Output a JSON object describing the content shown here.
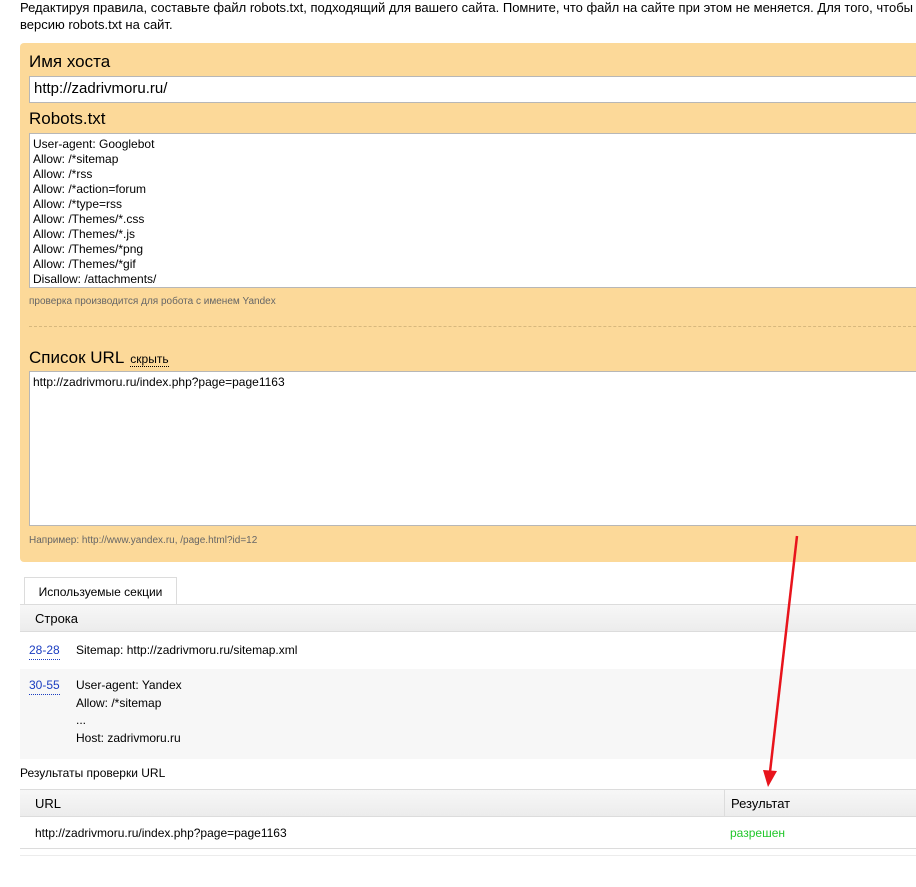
{
  "intro": {
    "line1": "Редактируя правила, составьте файл robots.txt, подходящий для вашего сайта. Помните, что файл на сайте при этом не меняется. Для того, чтобы",
    "line2": "версию robots.txt на сайт."
  },
  "form": {
    "host_label": "Имя хоста",
    "host_value": "http://zadrivmoru.ru/",
    "robots_label": "Robots.txt",
    "robots_lines": "User-agent: Googlebot\nAllow: /*sitemap\nAllow: /*rss\nAllow: /*action=forum\nAllow: /*type=rss\nAllow: /Themes/*.css\nAllow: /Themes/*.js\nAllow: /Themes/*png\nAllow: /Themes/*gif\nDisallow: /attachments/",
    "robots_hint": "проверка производится для робота с именем Yandex",
    "url_list_label": "Список URL",
    "hide_link": "скрыть",
    "url_list_value": "http://zadrivmoru.ru/index.php?page=page1163",
    "url_hint": "Например: http://www.yandex.ru, /page.html?id=12"
  },
  "sections": {
    "tab_label": "Используемые секции",
    "header": "Строка",
    "rows": [
      {
        "range": "28-28",
        "text": "Sitemap: http://zadrivmoru.ru/sitemap.xml"
      },
      {
        "range": "30-55",
        "text": "User-agent: Yandex\nAllow: /*sitemap\n...\nHost: zadrivmoru.ru"
      }
    ]
  },
  "results": {
    "title": "Результаты проверки URL",
    "col_url": "URL",
    "col_result": "Результат",
    "rows": [
      {
        "url": "http://zadrivmoru.ru/index.php?page=page1163",
        "result": "разрешен"
      }
    ]
  },
  "colors": {
    "panel": "#fcd999",
    "link": "#1a3dc1",
    "allowed": "#22c72b",
    "annotation_arrow": "#e8141c"
  }
}
